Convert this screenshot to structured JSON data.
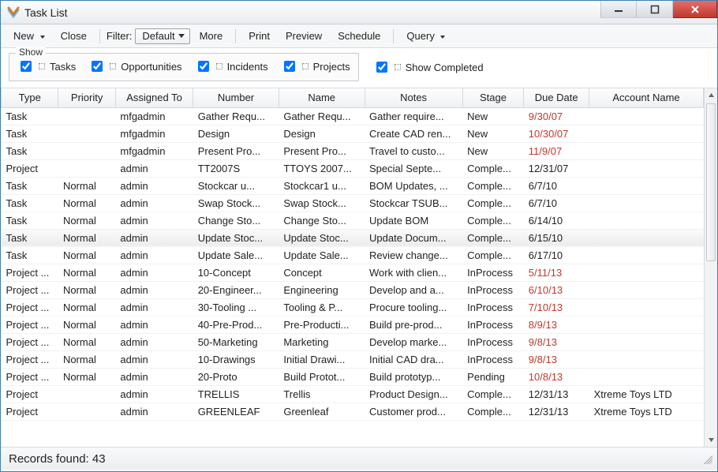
{
  "window": {
    "title": "Task List"
  },
  "toolbar": {
    "new": "New",
    "close": "Close",
    "filter_label": "Filter:",
    "filter_value": "Default",
    "more": "More",
    "print": "Print",
    "preview": "Preview",
    "schedule": "Schedule",
    "query": "Query"
  },
  "show_group": {
    "legend": "Show",
    "tasks": "Tasks",
    "opportunities": "Opportunities",
    "incidents": "Incidents",
    "projects": "Projects"
  },
  "show_completed": "Show Completed",
  "columns": {
    "type": "Type",
    "priority": "Priority",
    "assigned": "Assigned To",
    "number": "Number",
    "name": "Name",
    "notes": "Notes",
    "stage": "Stage",
    "due": "Due Date",
    "account": "Account Name"
  },
  "rows": [
    {
      "type": "Task",
      "priority": "",
      "assigned": "mfgadmin",
      "number": "Gather Requ...",
      "name": "Gather Requ...",
      "notes": "Gather require...",
      "stage": "New",
      "due": "9/30/07",
      "due_red": true,
      "account": ""
    },
    {
      "type": "Task",
      "priority": "",
      "assigned": "mfgadmin",
      "number": "Design",
      "name": "Design",
      "notes": "Create CAD ren...",
      "stage": "New",
      "due": "10/30/07",
      "due_red": true,
      "account": ""
    },
    {
      "type": "Task",
      "priority": "",
      "assigned": "mfgadmin",
      "number": "Present Pro...",
      "name": "Present Pro...",
      "notes": "Travel to custo...",
      "stage": "New",
      "due": "11/9/07",
      "due_red": true,
      "account": ""
    },
    {
      "type": "Project",
      "priority": "",
      "assigned": "admin",
      "number": "TT2007S",
      "name": "TTOYS 2007...",
      "notes": "Special Septe...",
      "stage": "Comple...",
      "due": "12/31/07",
      "due_red": false,
      "account": ""
    },
    {
      "type": "Task",
      "priority": "Normal",
      "assigned": "admin",
      "number": "Stockcar u...",
      "name": "Stockcar1 u...",
      "notes": "BOM Updates, ...",
      "stage": "Comple...",
      "due": "6/7/10",
      "due_red": false,
      "account": ""
    },
    {
      "type": "Task",
      "priority": "Normal",
      "assigned": "admin",
      "number": "Swap Stock...",
      "name": "Swap Stock...",
      "notes": "Stockcar TSUB...",
      "stage": "Comple...",
      "due": "6/7/10",
      "due_red": false,
      "account": ""
    },
    {
      "type": "Task",
      "priority": "Normal",
      "assigned": "admin",
      "number": "Change Sto...",
      "name": "Change Sto...",
      "notes": "Update BOM",
      "stage": "Comple...",
      "due": "6/14/10",
      "due_red": false,
      "account": ""
    },
    {
      "type": "Task",
      "priority": "Normal",
      "assigned": "admin",
      "number": "Update Stoc...",
      "name": "Update Stoc...",
      "notes": "Update Docum...",
      "stage": "Comple...",
      "due": "6/15/10",
      "due_red": false,
      "account": "",
      "hover": true
    },
    {
      "type": "Task",
      "priority": "Normal",
      "assigned": "admin",
      "number": "Update Sale...",
      "name": "Update Sale...",
      "notes": "Review change...",
      "stage": "Comple...",
      "due": "6/17/10",
      "due_red": false,
      "account": ""
    },
    {
      "type": "Project ...",
      "priority": "Normal",
      "assigned": "admin",
      "number": "10-Concept",
      "name": "Concept",
      "notes": "Work with clien...",
      "stage": "InProcess",
      "due": "5/11/13",
      "due_red": true,
      "account": ""
    },
    {
      "type": "Project ...",
      "priority": "Normal",
      "assigned": "admin",
      "number": "20-Engineer...",
      "name": "Engineering",
      "notes": "Develop and a...",
      "stage": "InProcess",
      "due": "6/10/13",
      "due_red": true,
      "account": ""
    },
    {
      "type": "Project ...",
      "priority": "Normal",
      "assigned": "admin",
      "number": "30-Tooling ...",
      "name": "Tooling & P...",
      "notes": "Procure tooling...",
      "stage": "InProcess",
      "due": "7/10/13",
      "due_red": true,
      "account": ""
    },
    {
      "type": "Project ...",
      "priority": "Normal",
      "assigned": "admin",
      "number": "40-Pre-Prod...",
      "name": "Pre-Producti...",
      "notes": "Build pre-prod...",
      "stage": "InProcess",
      "due": "8/9/13",
      "due_red": true,
      "account": ""
    },
    {
      "type": "Project ...",
      "priority": "Normal",
      "assigned": "admin",
      "number": "50-Marketing",
      "name": "Marketing",
      "notes": "Develop marke...",
      "stage": "InProcess",
      "due": "9/8/13",
      "due_red": true,
      "account": ""
    },
    {
      "type": "Project ...",
      "priority": "Normal",
      "assigned": "admin",
      "number": "10-Drawings",
      "name": "Initial Drawi...",
      "notes": "Initial CAD dra...",
      "stage": "InProcess",
      "due": "9/8/13",
      "due_red": true,
      "account": ""
    },
    {
      "type": "Project ...",
      "priority": "Normal",
      "assigned": "admin",
      "number": "20-Proto",
      "name": "Build Protot...",
      "notes": "Build prototyp...",
      "stage": "Pending",
      "due": "10/8/13",
      "due_red": true,
      "account": ""
    },
    {
      "type": "Project",
      "priority": "",
      "assigned": "admin",
      "number": "TRELLIS",
      "name": "Trellis",
      "notes": "Product Design...",
      "stage": "Comple...",
      "due": "12/31/13",
      "due_red": false,
      "account": "Xtreme Toys LTD"
    },
    {
      "type": "Project",
      "priority": "",
      "assigned": "admin",
      "number": "GREENLEAF",
      "name": "Greenleaf",
      "notes": "Customer prod...",
      "stage": "Comple...",
      "due": "12/31/13",
      "due_red": false,
      "account": "Xtreme Toys LTD"
    }
  ],
  "status": {
    "records": "Records found: 43"
  }
}
